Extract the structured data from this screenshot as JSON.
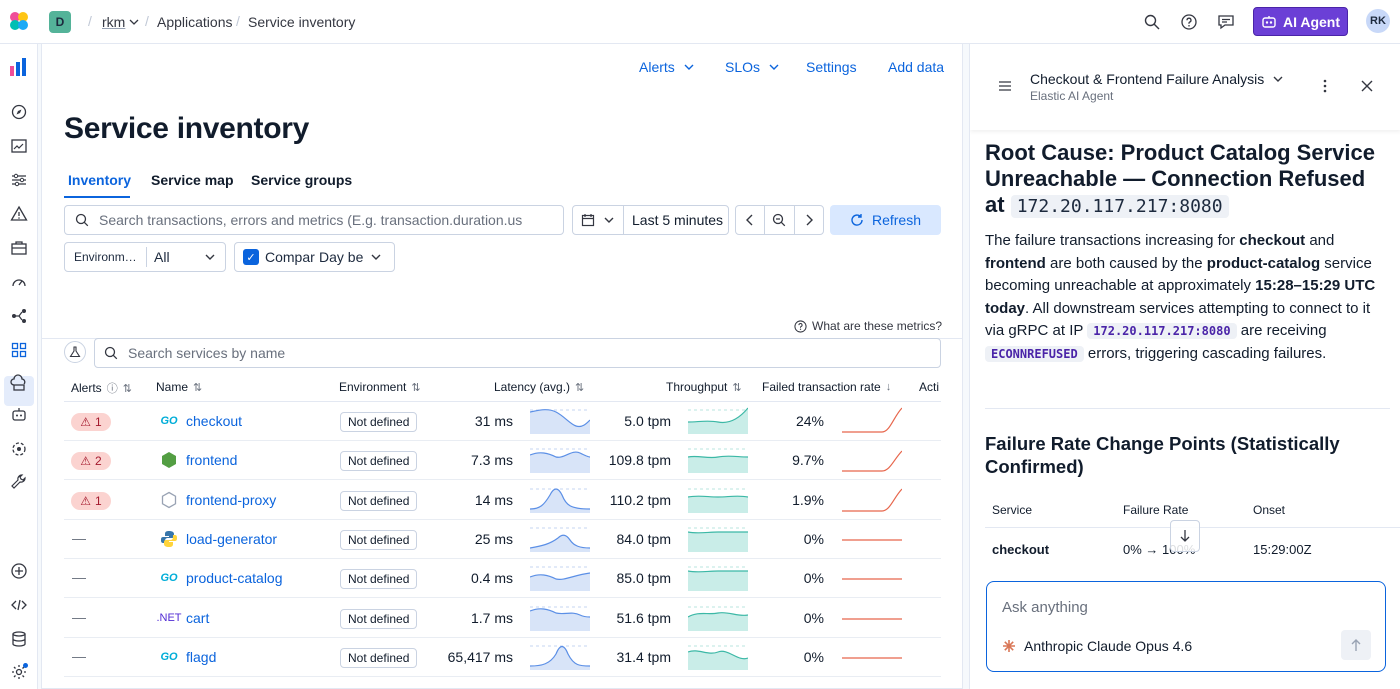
{
  "topbar": {
    "space_initial": "D",
    "breadcrumb_space": "rkm",
    "breadcrumb_app": "Applications",
    "breadcrumb_page": "Service inventory",
    "ai_agent_label": "AI Agent",
    "avatar_initials": "RK"
  },
  "header_links": {
    "alerts": "Alerts",
    "slos": "SLOs",
    "settings": "Settings",
    "add_data": "Add data"
  },
  "page": {
    "title": "Service inventory",
    "tabs": [
      "Inventory",
      "Service map",
      "Service groups"
    ],
    "search_placeholder": "Search transactions, errors and metrics (E.g. transaction.duration.us",
    "date_range": "Last 5 minutes",
    "refresh_label": "Refresh",
    "environment_label": "Environm…",
    "environment_value": "All",
    "compare_label": "Compar",
    "compare_value": "Day be",
    "metrics_help": "What are these metrics?",
    "service_search_placeholder": "Search services by name"
  },
  "table": {
    "headers": {
      "alerts": "Alerts",
      "name": "Name",
      "environment": "Environment",
      "latency": "Latency (avg.)",
      "throughput": "Throughput",
      "failed_rate": "Failed transaction rate",
      "actions": "Acti"
    },
    "rows": [
      {
        "alerts": "1",
        "icon": "go-icon",
        "icon_text": "GO",
        "name": "checkout",
        "env": "Not defined",
        "latency": "31 ms",
        "throughput": "5.0 tpm",
        "failed": "24%"
      },
      {
        "alerts": "2",
        "icon": "nodejs-icon",
        "icon_text": "",
        "name": "frontend",
        "env": "Not defined",
        "latency": "7.3 ms",
        "throughput": "109.8 tpm",
        "failed": "9.7%"
      },
      {
        "alerts": "1",
        "icon": "hexagon-icon",
        "icon_text": "",
        "name": "frontend-proxy",
        "env": "Not defined",
        "latency": "14 ms",
        "throughput": "110.2 tpm",
        "failed": "1.9%"
      },
      {
        "alerts": "",
        "icon": "python-icon",
        "icon_text": "",
        "name": "load-generator",
        "env": "Not defined",
        "latency": "25 ms",
        "throughput": "84.0 tpm",
        "failed": "0%"
      },
      {
        "alerts": "",
        "icon": "go-icon",
        "icon_text": "GO",
        "name": "product-catalog",
        "env": "Not defined",
        "latency": "0.4 ms",
        "throughput": "85.0 tpm",
        "failed": "0%"
      },
      {
        "alerts": "",
        "icon": "dotnet-icon",
        "icon_text": ".NET",
        "name": "cart",
        "env": "Not defined",
        "latency": "1.7 ms",
        "throughput": "51.6 tpm",
        "failed": "0%"
      },
      {
        "alerts": "",
        "icon": "go-icon",
        "icon_text": "GO",
        "name": "flagd",
        "env": "Not defined",
        "latency": "65,417 ms",
        "throughput": "31.4 tpm",
        "failed": "0%"
      }
    ]
  },
  "ai_panel": {
    "conversation_title": "Checkout & Frontend Failure Analysis",
    "subtitle": "Elastic AI Agent",
    "root_cause_heading": "Root Cause: Product Catalog Service Unreachable — Connection Refused at",
    "root_cause_ip": "172.20.117.217:8080",
    "para_1": "The failure transactions increasing for",
    "para_checkout": "checkout",
    "para_and": "and",
    "para_frontend": "frontend",
    "para_2": "are both caused by the",
    "para_catalog": "product-catalog",
    "para_3": "service becoming unreachable at approximately",
    "para_time": "15:28–15:29 UTC today",
    "para_4": ". All downstream services attempting to connect to it via gRPC at IP",
    "para_ip": "172.20.117.217:8080",
    "para_5": "are receiving",
    "para_err": "ECONNREFUSED",
    "para_6": "errors, triggering cascading failures.",
    "changepoints_heading": "Failure Rate Change Points (Statistically Confirmed)",
    "cp_headers": [
      "Service",
      "Failure Rate",
      "Onset"
    ],
    "cp_row": {
      "service": "checkout",
      "rate": "0% → 100%",
      "onset": "15:29:00Z"
    },
    "ask_placeholder": "Ask anything",
    "model_name": "Anthropic Claude Opus 4.6"
  },
  "colors": {
    "accent": "#0b64dd",
    "ai_button": "#6b3fd6",
    "alert_badge_bg": "#fbd3d0",
    "latency_spark": "#5b8fe6",
    "throughput_spark": "#3cb8a6",
    "failed_spark": "#e7664c"
  }
}
